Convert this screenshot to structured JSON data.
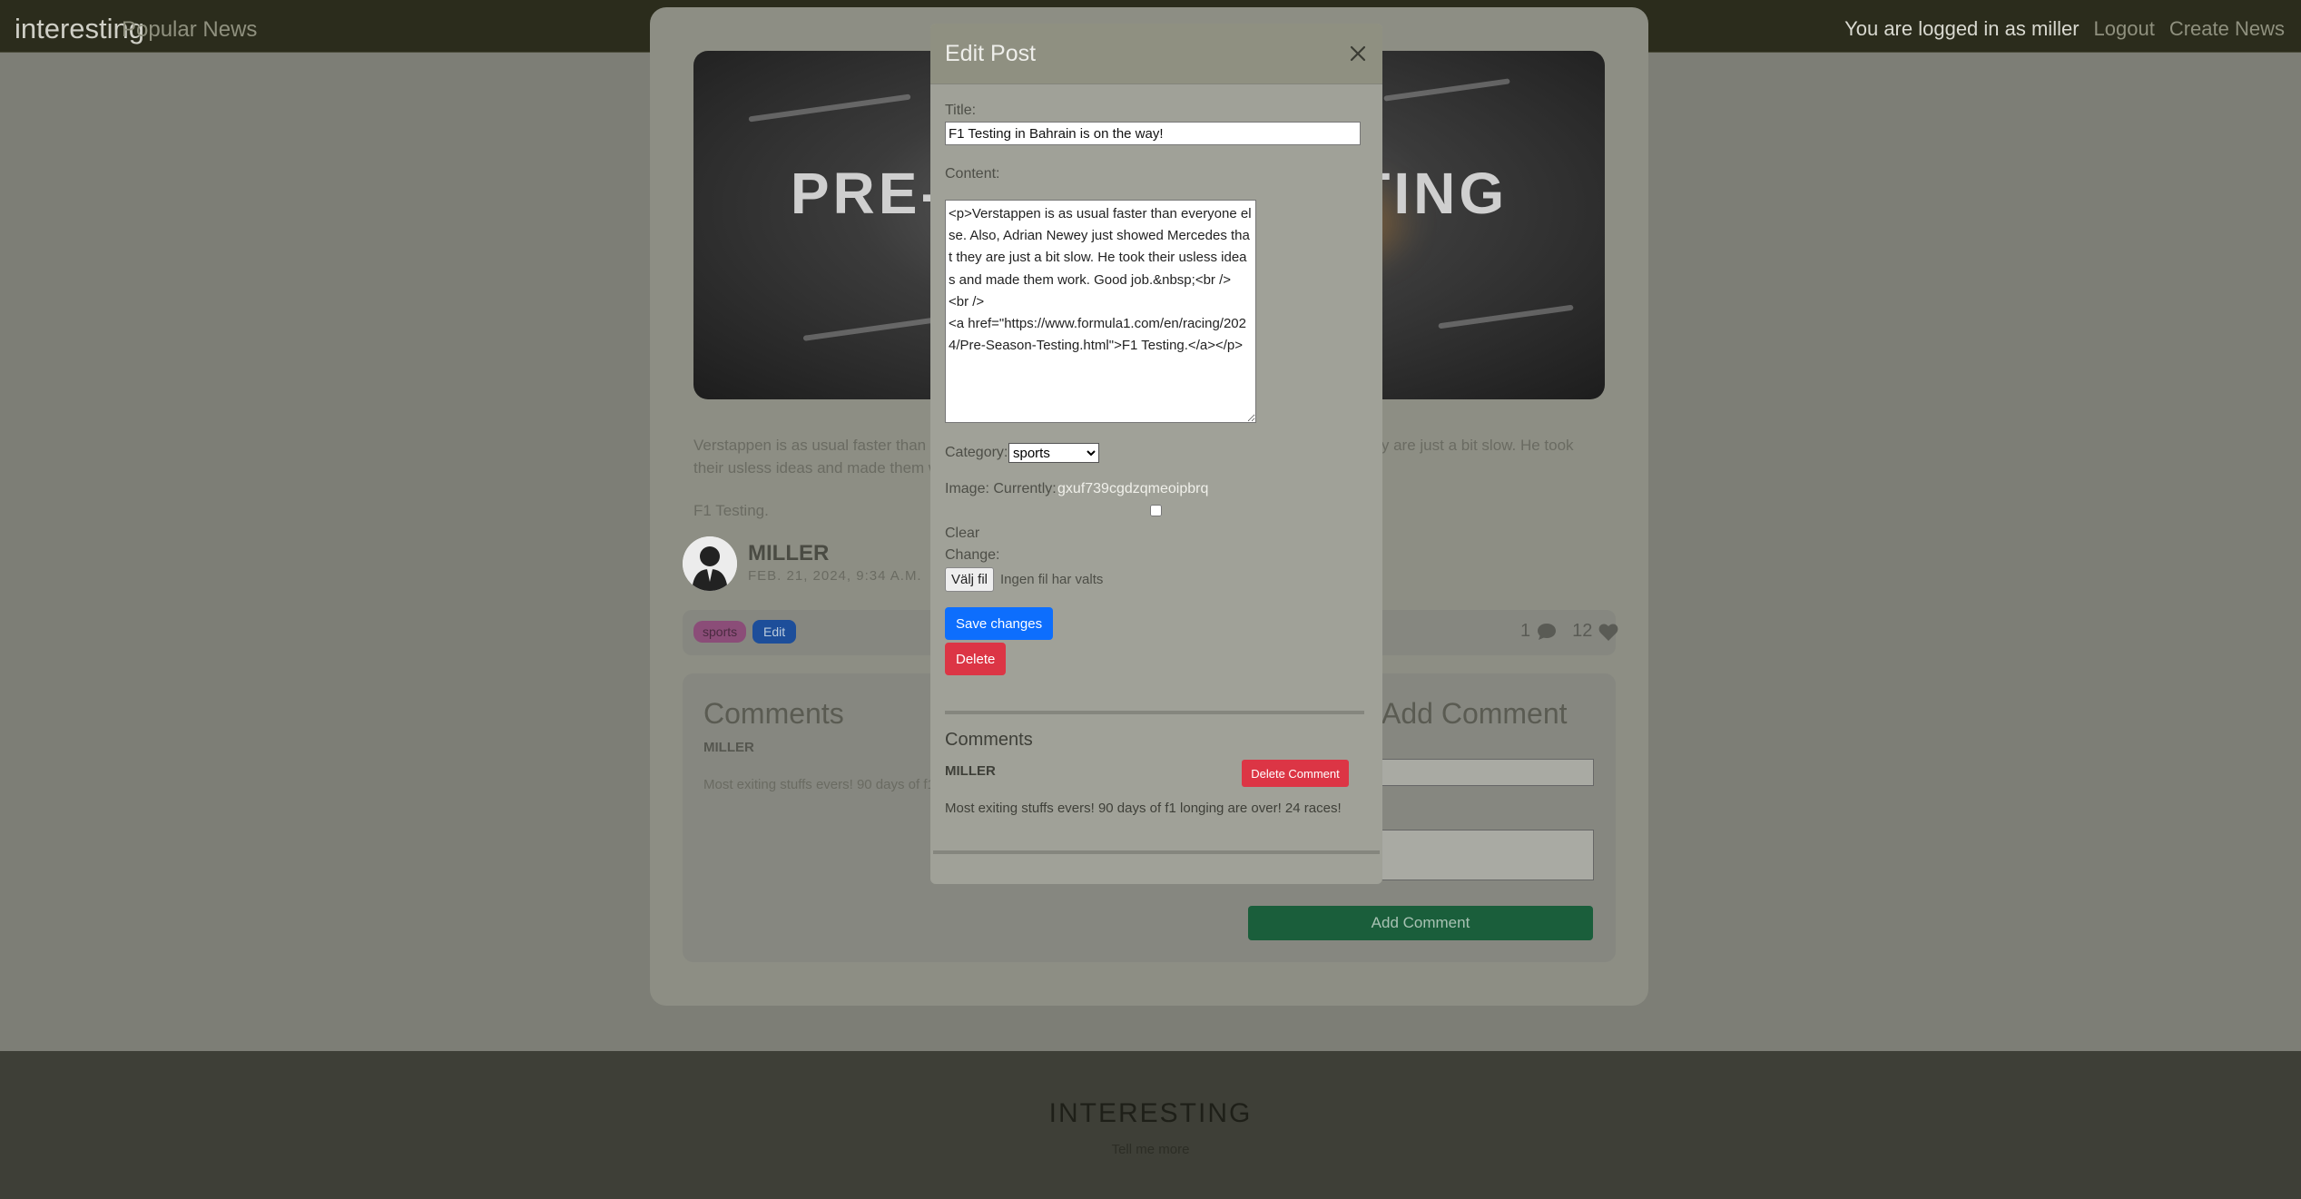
{
  "navbar": {
    "brand": "interesting",
    "popular": "Popular News",
    "status": "You are logged in as miller",
    "logout": "Logout",
    "create": "Create News"
  },
  "post": {
    "hero_text": "PRE-SEASON TESTING",
    "paragraph": "Verstappen is as usual faster than everyone else. Also, Adrian Newey just showed Mercedes that they are just a bit slow. He took their usless ideas and made them work. Good job.",
    "link_text": "F1 Testing.",
    "author": "MILLER",
    "date": "FEB. 21, 2024, 9:34 A.M.",
    "tag": "sports",
    "edit_label": "Edit",
    "comment_count": "1",
    "like_count": "12"
  },
  "bg_comments": {
    "title": "Comments",
    "add_title": "Add Comment",
    "author": "MILLER",
    "text": "Most exiting stuffs evers! 90 days of f1 longing are over! 24 races!",
    "add_button": "Add Comment"
  },
  "footer": {
    "title": "INTERESTING",
    "subtitle": "Tell me more"
  },
  "modal": {
    "title": "Edit Post",
    "title_label": "Title:",
    "title_value": "F1 Testing in Bahrain is on the way!",
    "content_label": "Content:",
    "content_value": "<p>Verstappen is as usual faster than everyone else. Also, Adrian Newey just showed Mercedes that they are just a bit slow. He took their usless ideas and made them work. Good job.&nbsp;<br />\n<br />\n<a href=\"https://www.formula1.com/en/racing/2024/Pre-Season-Testing.html\">F1 Testing.</a></p>",
    "category_label": "Category:",
    "category_value": "sports",
    "image_label": "Image: Currently:",
    "image_current": "gxuf739cgdzqmeoipbrq",
    "clear_label": "Clear",
    "change_label": "Change:",
    "file_button": "Välj fil",
    "file_none": "Ingen fil har valts",
    "save_button": "Save changes",
    "delete_button": "Delete",
    "comments_title": "Comments",
    "comment_author": "MILLER",
    "comment_delete": "Delete Comment",
    "comment_text": "Most exiting stuffs evers! 90 days of f1 longing are over! 24 races!"
  },
  "colors": {
    "primary": "#0d6efd",
    "danger": "#dc3545",
    "success": "#1a5e3b",
    "overlay": "#7d7e76"
  },
  "icons": [
    "close-icon",
    "comment-icon",
    "heart-icon",
    "avatar-icon"
  ]
}
